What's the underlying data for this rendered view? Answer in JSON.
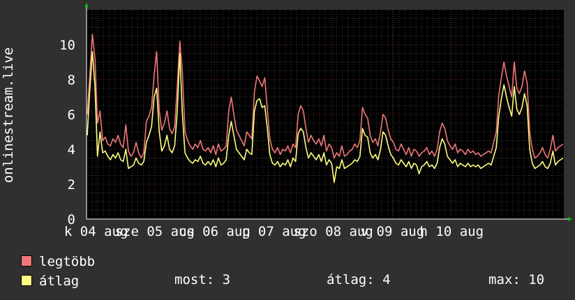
{
  "chart_data": {
    "type": "line",
    "ylabel": "onlinestream.live",
    "ylim": [
      0,
      12
    ],
    "yticks": [
      0,
      2,
      4,
      6,
      8,
      10
    ],
    "xlim": [
      0,
      100
    ],
    "x_tick_labels": [
      {
        "x": 2,
        "label": "k 04 aug"
      },
      {
        "x": 14.3,
        "label": "sze 05 aug"
      },
      {
        "x": 26.8,
        "label": "cs 06 aug"
      },
      {
        "x": 39.3,
        "label": "p 07 aug"
      },
      {
        "x": 51.7,
        "label": "szo 08 aug"
      },
      {
        "x": 64.1,
        "label": "v 09 aug"
      },
      {
        "x": 76.5,
        "label": "h 10 aug"
      }
    ],
    "grid": true,
    "series": [
      {
        "name": "legtöbb",
        "color": "#f07878",
        "values": [
          6,
          8.3,
          10.6,
          9.2,
          5.5,
          6.2,
          4.5,
          4.7,
          4.3,
          4.2,
          4.6,
          4.4,
          4.8,
          4.3,
          4.1,
          5.4,
          3.9,
          3.6,
          3.8,
          4.4,
          3.8,
          3.5,
          3.8,
          5.6,
          5.9,
          6.4,
          8.2,
          9.6,
          6.2,
          5.1,
          5.5,
          6.2,
          5.2,
          4.9,
          5.3,
          7.6,
          10.2,
          8.4,
          5.0,
          4.5,
          4.2,
          4.0,
          4.3,
          4.1,
          4.5,
          4.0,
          3.9,
          4.1,
          3.8,
          4.2,
          3.7,
          4.3,
          3.9,
          4.0,
          4.2,
          6.2,
          7.0,
          6.0,
          5.1,
          4.8,
          4.5,
          4.2,
          5.0,
          4.8,
          4.6,
          7.3,
          8.2,
          7.9,
          7.6,
          8.1,
          6.3,
          4.6,
          4.0,
          3.8,
          4.1,
          3.7,
          4.0,
          3.9,
          4.2,
          3.8,
          4.3,
          4.1,
          6.0,
          6.5,
          6.2,
          5.2,
          4.4,
          4.8,
          4.5,
          4.3,
          4.6,
          4.2,
          4.8,
          3.9,
          4.3,
          4.1,
          3.5,
          3.8,
          3.6,
          4.2,
          3.6,
          3.7,
          3.9,
          4.0,
          4.3,
          4.1,
          4.5,
          6.4,
          6.0,
          5.8,
          4.8,
          4.4,
          4.6,
          4.2,
          5.0,
          6.0,
          5.8,
          5.1,
          4.6,
          4.4,
          4.0,
          3.9,
          4.3,
          4.0,
          3.7,
          4.1,
          3.6,
          4.0,
          3.9,
          3.6,
          3.8,
          3.9,
          4.1,
          3.7,
          3.9,
          3.6,
          4.0,
          5.0,
          5.5,
          5.2,
          4.5,
          4.2,
          4.0,
          4.3,
          3.8,
          4.0,
          3.9,
          3.7,
          4.0,
          3.8,
          3.9,
          3.7,
          3.8,
          3.6,
          3.7,
          3.8,
          3.9,
          3.8,
          4.4,
          5.0,
          7.1,
          8.1,
          9.0,
          8.2,
          7.6,
          7.0,
          9.0,
          7.5,
          7.2,
          7.6,
          8.5,
          7.8,
          5.0,
          4.0,
          3.5,
          3.6,
          3.8,
          4.1,
          3.7,
          3.5,
          4.0,
          4.8,
          3.9,
          4.1,
          4.2,
          4.3
        ]
      },
      {
        "name": "átlag",
        "color": "#ffff80",
        "values": [
          4.8,
          7.4,
          9.6,
          7.6,
          3.6,
          5.0,
          3.8,
          3.9,
          3.6,
          3.4,
          3.7,
          3.5,
          3.8,
          3.4,
          3.3,
          4.0,
          2.9,
          3.0,
          3.1,
          3.5,
          3.2,
          3.1,
          3.3,
          4.4,
          4.8,
          5.3,
          7.0,
          7.5,
          5.0,
          3.9,
          4.2,
          4.8,
          4.0,
          3.8,
          4.2,
          6.2,
          9.5,
          6.0,
          3.8,
          3.5,
          3.3,
          3.2,
          3.4,
          3.3,
          3.6,
          3.2,
          3.1,
          3.3,
          3.1,
          3.4,
          3.0,
          3.5,
          3.1,
          3.2,
          3.4,
          4.8,
          5.6,
          4.8,
          4.0,
          3.8,
          3.6,
          3.4,
          4.0,
          3.8,
          3.7,
          6.2,
          6.8,
          6.9,
          6.4,
          6.5,
          5.2,
          3.7,
          3.2,
          3.1,
          3.3,
          3.0,
          3.2,
          3.1,
          3.4,
          3.0,
          3.5,
          3.3,
          4.9,
          5.2,
          5.0,
          4.1,
          3.5,
          3.8,
          3.6,
          3.4,
          3.7,
          3.3,
          3.8,
          3.1,
          3.4,
          3.2,
          2.1,
          3.0,
          2.9,
          3.4,
          2.9,
          3.0,
          3.1,
          3.2,
          3.4,
          3.3,
          3.6,
          5.2,
          4.8,
          4.7,
          3.8,
          3.5,
          3.7,
          3.4,
          4.0,
          5.0,
          4.8,
          4.2,
          3.7,
          3.5,
          3.2,
          3.1,
          3.4,
          3.2,
          3.0,
          3.3,
          2.9,
          3.2,
          3.1,
          2.6,
          3.0,
          3.1,
          3.3,
          3.0,
          3.1,
          2.9,
          3.2,
          4.1,
          4.6,
          4.3,
          3.6,
          3.4,
          3.2,
          3.4,
          3.0,
          3.2,
          3.1,
          3.0,
          3.2,
          3.0,
          3.1,
          3.0,
          3.1,
          2.9,
          3.0,
          3.1,
          3.2,
          3.1,
          3.6,
          4.1,
          5.9,
          6.9,
          7.7,
          7.0,
          6.4,
          5.9,
          7.6,
          6.3,
          6.0,
          6.4,
          7.2,
          6.5,
          4.0,
          3.2,
          2.9,
          3.0,
          3.1,
          3.3,
          3.0,
          2.9,
          3.2,
          3.9,
          3.1,
          3.3,
          3.4,
          3.5
        ]
      }
    ]
  },
  "legend": [
    {
      "label": "legtöbb",
      "color": "#f07878"
    },
    {
      "label": "átlag",
      "color": "#ffff80"
    }
  ],
  "stats": {
    "most_label": "most: 3",
    "atlag_label": "átlag: 4",
    "max_label": "max: 10"
  }
}
